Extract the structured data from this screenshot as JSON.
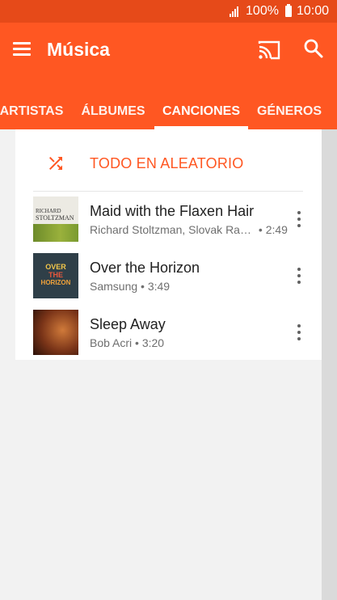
{
  "status_bar": {
    "battery": "100%",
    "time": "10:00"
  },
  "app_bar": {
    "title": "Música",
    "brand_color": "#ff5722",
    "status_color": "#e64a19"
  },
  "tabs": [
    {
      "label": "ARTISTAS"
    },
    {
      "label": "ÁLBUMES"
    },
    {
      "label": "CANCIONES",
      "active": true
    },
    {
      "label": "GÉNEROS"
    }
  ],
  "shuffle": {
    "label": "TODO EN ALEATORIO",
    "icon": "shuffle-icon"
  },
  "songs": [
    {
      "title": "Maid with the Flaxen Hair",
      "artist": "Richard Stoltzman, Slovak Radi...",
      "duration": "2:49",
      "art_text_1": "RICHARD",
      "art_text_2": "STOLTZMAN"
    },
    {
      "title": "Over the Horizon",
      "artist": "Samsung",
      "duration": "3:49",
      "art_text_1": "OVER",
      "art_text_2": "THE",
      "art_text_3": "HORIZON"
    },
    {
      "title": "Sleep Away",
      "artist": "Bob Acri",
      "duration": "3:20"
    }
  ],
  "separator": " • "
}
